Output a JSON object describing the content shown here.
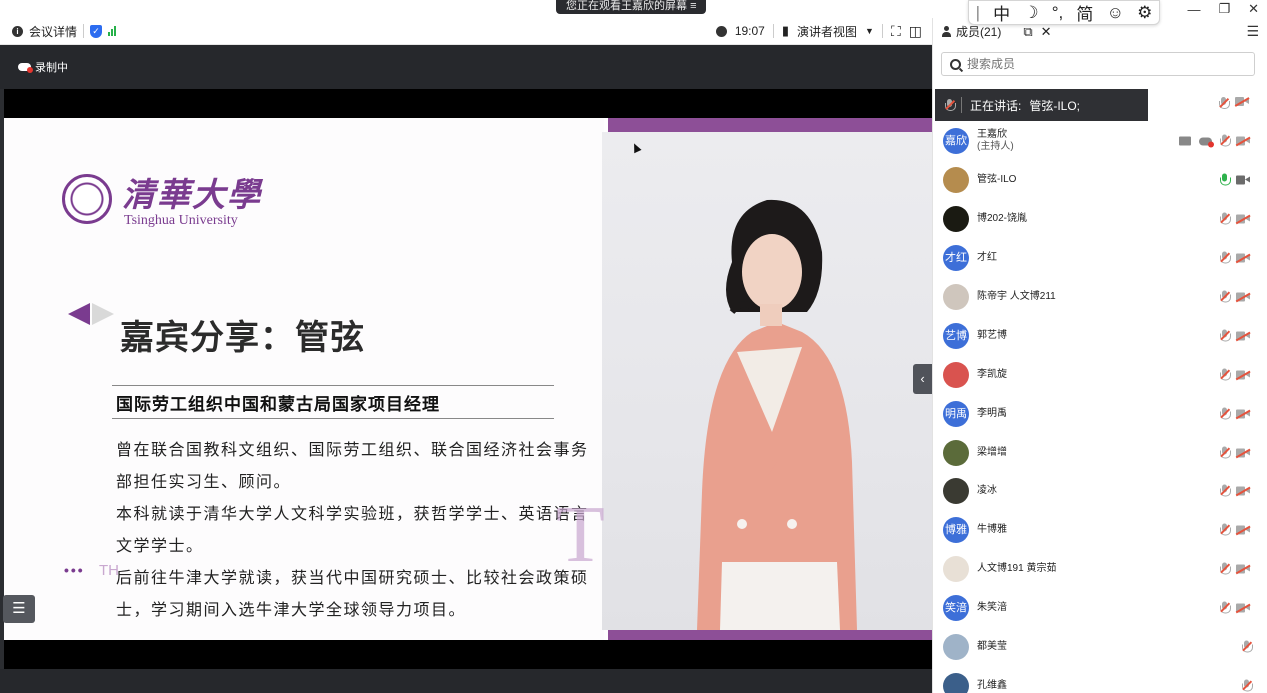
{
  "share_banner": "您正在观看王嘉欣的屏幕",
  "ime": {
    "cursor": "|",
    "lang": "中",
    "moon": "☽",
    "punct": "°,",
    "script": "简",
    "emoji": "☺",
    "settings": "⚙"
  },
  "window_controls": {
    "minimize": "—",
    "restore": "❐",
    "close": "✕"
  },
  "toolbar": {
    "meeting_details": "会议详情",
    "time": "19:07",
    "view_mode": "演讲者视图",
    "fullscreen_icon": "⛶",
    "layout_icon": "◫"
  },
  "recording": {
    "label": "录制中"
  },
  "slide": {
    "logo_cn": "清華大學",
    "logo_en": "Tsinghua University",
    "title": "嘉宾分享：管弦",
    "subtitle": "国际劳工组织中国和蒙古局国家项目经理",
    "body_lines": [
      "曾在联合国教科文组织、国际劳工组织、联合国经济社会事务",
      "部担任实习生、顾问。",
      "本科就读于清华大学人文科学实验班，获哲学学士、英语语言",
      "文学学士。",
      "后前往牛津大学就读，获当代中国研究硕士、比较社会政策硕",
      "士，学习期间入选牛津大学全球领导力项目。"
    ],
    "deco_letter": "T",
    "deco_dots": "•••",
    "deco_th": "TH"
  },
  "stage": {
    "list_icon": "☰",
    "collapse_icon": "‹"
  },
  "panel": {
    "title": "成员(21)",
    "popout_icon": "⧉",
    "close_icon": "✕",
    "menu_icon": "☰",
    "search_placeholder": "搜索成员",
    "speaking_prefix": "正在讲话:",
    "speaking_name": "管弦-ILO;"
  },
  "members": [
    {
      "name": "王嘉欣",
      "sub": "(主持人)",
      "avatar_text": "嘉欣",
      "avatar_color": "#3d6fd8",
      "mic": "muted",
      "cam": "off",
      "host": true
    },
    {
      "name": "管弦-ILO",
      "sub": "",
      "avatar_text": "",
      "avatar_color": "#b58c4e",
      "mic": "on",
      "cam": "on"
    },
    {
      "name": "博202-饶胤",
      "sub": "",
      "avatar_text": "",
      "avatar_color": "#1a1a12",
      "mic": "muted",
      "cam": "off"
    },
    {
      "name": "才红",
      "sub": "",
      "avatar_text": "才红",
      "avatar_color": "#3d6fd8",
      "mic": "muted",
      "cam": "off"
    },
    {
      "name": "陈帝宇 人文博211",
      "sub": "",
      "avatar_text": "",
      "avatar_color": "#cfc6bd",
      "mic": "muted",
      "cam": "off"
    },
    {
      "name": "郭艺博",
      "sub": "",
      "avatar_text": "艺博",
      "avatar_color": "#3d6fd8",
      "mic": "muted",
      "cam": "off"
    },
    {
      "name": "李凯旋",
      "sub": "",
      "avatar_text": "",
      "avatar_color": "#d9534f",
      "mic": "muted",
      "cam": "off"
    },
    {
      "name": "李明禹",
      "sub": "",
      "avatar_text": "明禹",
      "avatar_color": "#3d6fd8",
      "mic": "muted",
      "cam": "off"
    },
    {
      "name": "梁增增",
      "sub": "",
      "avatar_text": "",
      "avatar_color": "#5b6b3a",
      "mic": "muted",
      "cam": "off"
    },
    {
      "name": "凌冰",
      "sub": "",
      "avatar_text": "",
      "avatar_color": "#3a3a32",
      "mic": "muted",
      "cam": "off"
    },
    {
      "name": "牛博雅",
      "sub": "",
      "avatar_text": "博雅",
      "avatar_color": "#3d6fd8",
      "mic": "muted",
      "cam": "off"
    },
    {
      "name": "人文博191 黄宗茹",
      "sub": "",
      "avatar_text": "",
      "avatar_color": "#e8e0d6",
      "mic": "muted",
      "cam": "off"
    },
    {
      "name": "朱笑湆",
      "sub": "",
      "avatar_text": "笑湆",
      "avatar_color": "#3d6fd8",
      "mic": "muted",
      "cam": "off"
    },
    {
      "name": "都美莹",
      "sub": "",
      "avatar_text": "",
      "avatar_color": "#9fb3c8",
      "mic": "muted",
      "cam": "none"
    },
    {
      "name": "孔维鑫",
      "sub": "",
      "avatar_text": "",
      "avatar_color": "#3b5f8a",
      "mic": "muted",
      "cam": "none"
    }
  ]
}
